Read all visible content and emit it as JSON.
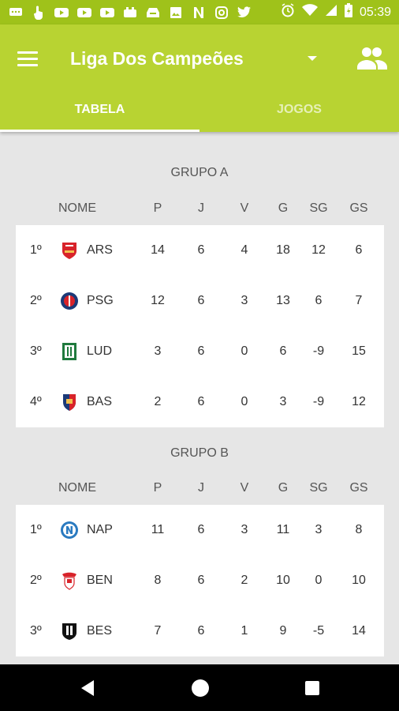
{
  "status_bar": {
    "time": "05:39",
    "left_icons": [
      "messages-icon",
      "hand-icon",
      "youtube-icon",
      "youtube-icon",
      "youtube-icon",
      "game-icon",
      "inbox-icon",
      "image-icon",
      "netflix-icon",
      "instagram-icon",
      "twitter-icon"
    ],
    "right_icons": [
      "alarm-icon",
      "wifi-icon",
      "signal-icon",
      "battery-icon"
    ]
  },
  "app_bar": {
    "title": "Liga Dos Campeões",
    "accent": "#b8d332",
    "status_color": "#9fc21a"
  },
  "tabs": [
    {
      "label": "TABELA",
      "active": true
    },
    {
      "label": "JOGOS",
      "active": false
    }
  ],
  "columns": {
    "name": "NOME",
    "p": "P",
    "j": "J",
    "v": "V",
    "g": "G",
    "sg": "SG",
    "gs": "GS"
  },
  "groups": [
    {
      "title": "GRUPO A",
      "rows": [
        {
          "pos": "1º",
          "team": "ARS",
          "crest": "arsenal-crest-icon",
          "p": "14",
          "j": "6",
          "v": "4",
          "g": "18",
          "sg": "12",
          "gs": "6"
        },
        {
          "pos": "2º",
          "team": "PSG",
          "crest": "psg-crest-icon",
          "p": "12",
          "j": "6",
          "v": "3",
          "g": "13",
          "sg": "6",
          "gs": "7"
        },
        {
          "pos": "3º",
          "team": "LUD",
          "crest": "ludogorets-crest-icon",
          "p": "3",
          "j": "6",
          "v": "0",
          "g": "6",
          "sg": "-9",
          "gs": "15"
        },
        {
          "pos": "4º",
          "team": "BAS",
          "crest": "basel-crest-icon",
          "p": "2",
          "j": "6",
          "v": "0",
          "g": "3",
          "sg": "-9",
          "gs": "12"
        }
      ]
    },
    {
      "title": "GRUPO B",
      "rows": [
        {
          "pos": "1º",
          "team": "NAP",
          "crest": "napoli-crest-icon",
          "p": "11",
          "j": "6",
          "v": "3",
          "g": "11",
          "sg": "3",
          "gs": "8"
        },
        {
          "pos": "2º",
          "team": "BEN",
          "crest": "benfica-crest-icon",
          "p": "8",
          "j": "6",
          "v": "2",
          "g": "10",
          "sg": "0",
          "gs": "10"
        },
        {
          "pos": "3º",
          "team": "BES",
          "crest": "besiktas-crest-icon",
          "p": "7",
          "j": "6",
          "v": "1",
          "g": "9",
          "sg": "-5",
          "gs": "14"
        }
      ]
    }
  ],
  "nav_bar": {
    "icons": [
      "back-icon",
      "home-icon",
      "recents-icon"
    ]
  }
}
